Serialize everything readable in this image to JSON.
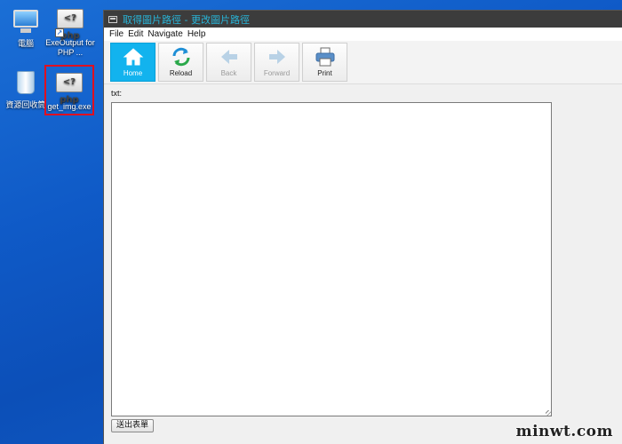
{
  "desktop": {
    "icons": [
      {
        "label": "電腦"
      },
      {
        "label": "ExeOutput for PHP ..."
      },
      {
        "label": "資源回收筒"
      },
      {
        "label": "get_img.exe"
      }
    ],
    "php_badge_text": "<?php"
  },
  "window": {
    "title": "取得圖片路徑 - 更改圖片路徑",
    "menu": [
      "File",
      "Edit",
      "Navigate",
      "Help"
    ],
    "toolbar": [
      {
        "label": "Home",
        "icon": "home-icon",
        "state": "active"
      },
      {
        "label": "Reload",
        "icon": "reload-icon",
        "state": "enabled"
      },
      {
        "label": "Back",
        "icon": "back-arrow-icon",
        "state": "disabled"
      },
      {
        "label": "Forward",
        "icon": "forward-arrow-icon",
        "state": "disabled"
      },
      {
        "label": "Print",
        "icon": "printer-icon",
        "state": "enabled"
      }
    ],
    "field_label": "txt:",
    "textarea_value": "",
    "submit_label": "送出表單"
  },
  "watermark": "minwt.com",
  "colors": {
    "desktop_bg": "#0f5ac7",
    "titlebar_bg": "#3c3c3c",
    "title_text": "#28b4d8",
    "active_button": "#12b3ee",
    "selection_frame": "#e01020"
  }
}
